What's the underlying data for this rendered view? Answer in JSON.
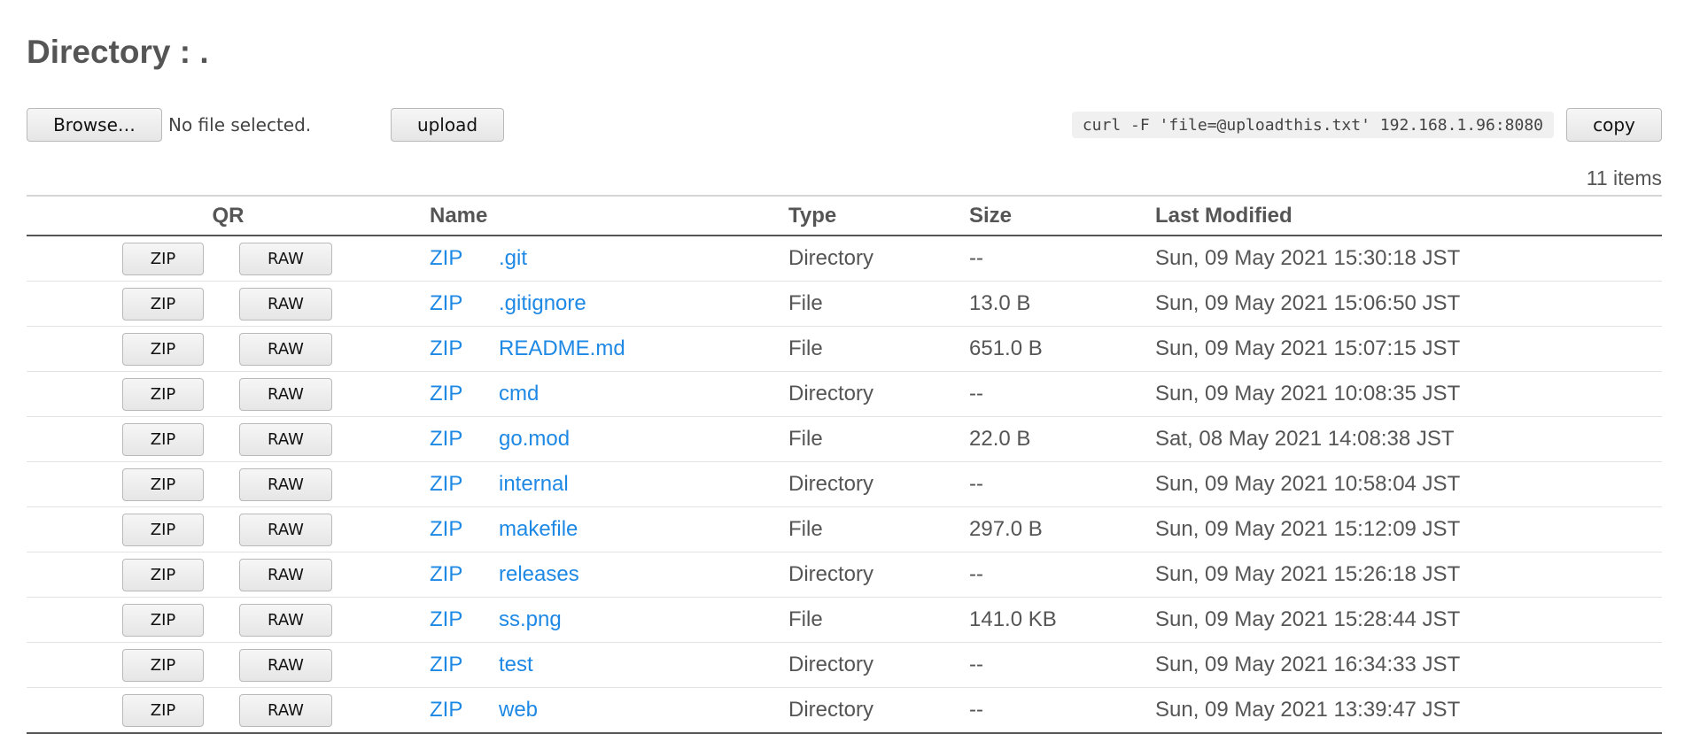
{
  "page": {
    "title": "Directory : ."
  },
  "upload": {
    "browse_label": "Browse…",
    "file_status": "No file selected.",
    "upload_label": "upload",
    "curl_command": "curl -F 'file=@uploadthis.txt' 192.168.1.96:8080",
    "copy_label": "copy"
  },
  "listing": {
    "item_count": "11 items",
    "headers": {
      "qr": "QR",
      "name": "Name",
      "type": "Type",
      "size": "Size",
      "modified": "Last Modified"
    },
    "qr_zip_label": "ZIP",
    "qr_raw_label": "RAW",
    "zip_link_label": "ZIP",
    "rows": [
      {
        "name": ".git",
        "type": "Directory",
        "size": "--",
        "modified": "Sun, 09 May 2021 15:30:18 JST"
      },
      {
        "name": ".gitignore",
        "type": "File",
        "size": "13.0 B",
        "modified": "Sun, 09 May 2021 15:06:50 JST"
      },
      {
        "name": "README.md",
        "type": "File",
        "size": "651.0 B",
        "modified": "Sun, 09 May 2021 15:07:15 JST"
      },
      {
        "name": "cmd",
        "type": "Directory",
        "size": "--",
        "modified": "Sun, 09 May 2021 10:08:35 JST"
      },
      {
        "name": "go.mod",
        "type": "File",
        "size": "22.0 B",
        "modified": "Sat, 08 May 2021 14:08:38 JST"
      },
      {
        "name": "internal",
        "type": "Directory",
        "size": "--",
        "modified": "Sun, 09 May 2021 10:58:04 JST"
      },
      {
        "name": "makefile",
        "type": "File",
        "size": "297.0 B",
        "modified": "Sun, 09 May 2021 15:12:09 JST"
      },
      {
        "name": "releases",
        "type": "Directory",
        "size": "--",
        "modified": "Sun, 09 May 2021 15:26:18 JST"
      },
      {
        "name": "ss.png",
        "type": "File",
        "size": "141.0 KB",
        "modified": "Sun, 09 May 2021 15:28:44 JST"
      },
      {
        "name": "test",
        "type": "Directory",
        "size": "--",
        "modified": "Sun, 09 May 2021 16:34:33 JST"
      },
      {
        "name": "web",
        "type": "Directory",
        "size": "--",
        "modified": "Sun, 09 May 2021 13:39:47 JST"
      }
    ]
  },
  "colors": {
    "link": "#1e88e5",
    "text": "#555555",
    "header_rule": "#555555"
  }
}
